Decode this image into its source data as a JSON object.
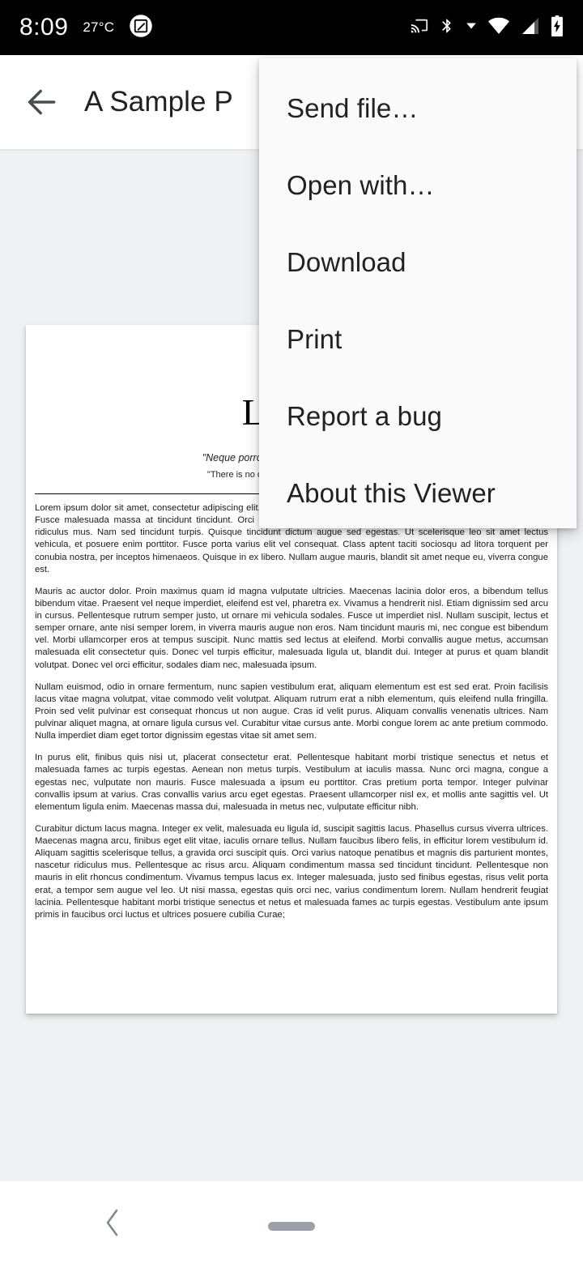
{
  "status_bar": {
    "time": "8:09",
    "temperature": "27°C",
    "left_icons": [
      "screenshot-icon"
    ],
    "right_icons": [
      "cast-icon",
      "bluetooth-icon",
      "data-arrow-icon",
      "wifi-icon",
      "cellular-signal-icon",
      "battery-charging-icon"
    ],
    "background_color": "#000000",
    "foreground_color": "#ffffff"
  },
  "app_bar": {
    "back_label": "Back",
    "title": "A Sample P",
    "background_color": "#ffffff",
    "title_color": "#202124"
  },
  "overflow_menu": {
    "visible": true,
    "background_color": "#fafafa",
    "items": [
      {
        "label": "Send file…",
        "name": "menu-item-send-file"
      },
      {
        "label": "Open with…",
        "name": "menu-item-open-with"
      },
      {
        "label": "Download",
        "name": "menu-item-download"
      },
      {
        "label": "Print",
        "name": "menu-item-print"
      },
      {
        "label": "Report a bug",
        "name": "menu-item-report-a-bug"
      },
      {
        "label": "About this Viewer",
        "name": "menu-item-about-this-viewer"
      }
    ]
  },
  "document": {
    "background_color": "#f0f1f3",
    "page_color": "#ffffff",
    "heading": "Lorem",
    "quote_latin": "\"Neque porro quisquam est qui dolorem",
    "quote_english": "\"There is no one who loves pain itself, who",
    "paragraphs": [
      "Lorem ipsum dolor sit amet, consectetur adipiscing elit. Nulla scelerisque massa, non ornare turpis eleifend tincidunt pulvinar. Fusce malesuada massa at tincidunt tincidunt. Orci varius natoque penatibus et magnis dis parturient montes, nascetur ridiculus mus. Nam sed tincidunt turpis. Quisque tincidunt dictum augue sed egestas. Ut scelerisque leo sit amet lectus vehicula, et posuere enim porttitor. Fusce porta varius elit vel consequat. Class aptent taciti sociosqu ad litora torquent per conubia nostra, per inceptos himenaeos. Quisque in ex libero. Nullam augue mauris, blandit sit amet neque eu, viverra congue est.",
      "Mauris ac auctor dolor. Proin maximus quam id magna vulputate ultricies. Maecenas lacinia dolor eros, a bibendum tellus bibendum vitae. Praesent vel neque imperdiet, eleifend est vel, pharetra ex. Vivamus a hendrerit nisl. Etiam dignissim sed arcu in cursus. Pellentesque rutrum semper justo, ut ornare mi vehicula sodales. Fusce ut imperdiet nisl. Nullam suscipit, lectus et semper ornare, ante nisi semper lorem, in viverra mauris augue non eros. Nam tincidunt mauris mi, nec congue est bibendum vel. Morbi ullamcorper eros at tempus suscipit. Nunc mattis sed lectus at eleifend. Morbi convallis augue metus, accumsan malesuada elit consectetur quis. Donec vel turpis efficitur, malesuada ligula ut, blandit dui. Integer at purus et quam blandit volutpat. Donec vel orci efficitur, sodales diam nec, malesuada ipsum.",
      "Nullam euismod, odio in ornare fermentum, nunc sapien vestibulum erat, aliquam elementum est est sed erat. Proin facilisis lacus vitae magna volutpat, vitae commodo velit volutpat. Aliquam rutrum erat a nibh elementum, quis eleifend nulla fringilla. Proin sed velit pulvinar est consequat rhoncus ut non augue. Cras id velit purus. Aliquam convallis venenatis ultrices. Nam pulvinar aliquet magna, at ornare ligula cursus vel. Curabitur vitae cursus ante. Morbi congue lorem ac ante pretium commodo. Nulla imperdiet diam eget tortor dignissim egestas vitae sit amet sem.",
      "In purus elit, finibus quis nisi ut, placerat consectetur erat. Pellentesque habitant morbi tristique senectus et netus et malesuada fames ac turpis egestas. Aenean non metus turpis. Vestibulum at iaculis massa. Nunc orci magna, congue a egestas nec, vulputate non mauris. Fusce malesuada a ipsum eu porttitor. Cras pretium porta tempor. Integer pulvinar convallis ipsum at varius. Cras convallis varius arcu eget egestas. Praesent ullamcorper nisl ex, et mollis ante sagittis vel. Ut elementum ligula enim. Maecenas massa dui, malesuada in metus nec, vulputate efficitur nibh.",
      "Curabitur dictum lacus magna. Integer ex velit, malesuada eu ligula id, suscipit sagittis lacus. Phasellus cursus viverra ultrices. Maecenas magna arcu, finibus eget elit vitae, iaculis ornare tellus. Nullam faucibus libero felis, in efficitur lorem vestibulum id. Aliquam sagittis scelerisque tellus, a gravida orci suscipit quis. Orci varius natoque penatibus et magnis dis parturient montes, nascetur ridiculus mus. Pellentesque ac risus arcu. Aliquam condimentum massa sed tincidunt tincidunt. Pellentesque non mauris in elit rhoncus condimentum. Vivamus tempus lacus ex. Integer malesuada, justo sed finibus egestas, risus velit porta erat, a tempor sem augue vel leo. Ut nisi massa, egestas quis orci nec, varius condimentum lorem. Nullam hendrerit feugiat lacinia. Pellentesque habitant morbi tristique senectus et netus et malesuada fames ac turpis egestas. Vestibulum ante ipsum primis in faucibus orci luctus et ultrices posuere cubilia Curae;"
    ]
  },
  "nav_bar": {
    "back_label": "Back",
    "gesture_pill_color": "#9aa0a6",
    "background_color": "#ffffff"
  }
}
